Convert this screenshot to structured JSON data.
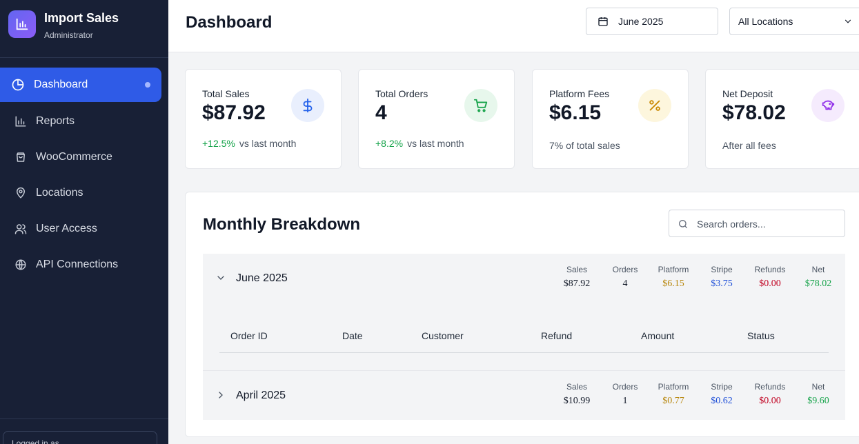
{
  "app": {
    "name": "Import Sales",
    "role": "Administrator"
  },
  "sidebar": {
    "items": [
      {
        "label": "Dashboard",
        "icon": "dashboard-icon",
        "active": true
      },
      {
        "label": "Reports",
        "icon": "bar-chart-icon"
      },
      {
        "label": "WooCommerce",
        "icon": "shopping-bag-icon"
      },
      {
        "label": "Locations",
        "icon": "map-pin-icon"
      },
      {
        "label": "User Access",
        "icon": "users-icon"
      },
      {
        "label": "API Connections",
        "icon": "globe-icon"
      }
    ],
    "footer_text": "Logged in as"
  },
  "header": {
    "title": "Dashboard",
    "date_value": "June 2025",
    "location_value": "All Locations"
  },
  "stats": [
    {
      "label": "Total Sales",
      "value": "$87.92",
      "change": "+12.5%",
      "note": "vs last month",
      "icon": "dollar-icon",
      "color": "#2563eb"
    },
    {
      "label": "Total Orders",
      "value": "4",
      "change": "+8.2%",
      "note": "vs last month",
      "icon": "cart-icon",
      "color": "#16a34a"
    },
    {
      "label": "Platform Fees",
      "value": "$6.15",
      "note": "7% of total sales",
      "icon": "percent-icon",
      "color": "#ca8a04"
    },
    {
      "label": "Net Deposit",
      "value": "$78.02",
      "note": "After all fees",
      "icon": "piggy-bank-icon",
      "color": "#9333ea"
    }
  ],
  "breakdown": {
    "title": "Monthly Breakdown",
    "search_placeholder": "Search orders...",
    "metric_labels": {
      "sales": "Sales",
      "orders": "Orders",
      "platform": "Platform",
      "stripe": "Stripe",
      "refunds": "Refunds",
      "net": "Net"
    },
    "months": [
      {
        "name": "June 2025",
        "expanded": true,
        "sales": "$87.92",
        "orders": "4",
        "platform": "$6.15",
        "stripe": "$3.75",
        "refunds": "$0.00",
        "net": "$78.02"
      },
      {
        "name": "April 2025",
        "expanded": false,
        "sales": "$10.99",
        "orders": "1",
        "platform": "$0.77",
        "stripe": "$0.62",
        "refunds": "$0.00",
        "net": "$9.60"
      }
    ],
    "columns": [
      "Order ID",
      "Date",
      "Customer",
      "Refund",
      "Amount",
      "Status"
    ]
  }
}
